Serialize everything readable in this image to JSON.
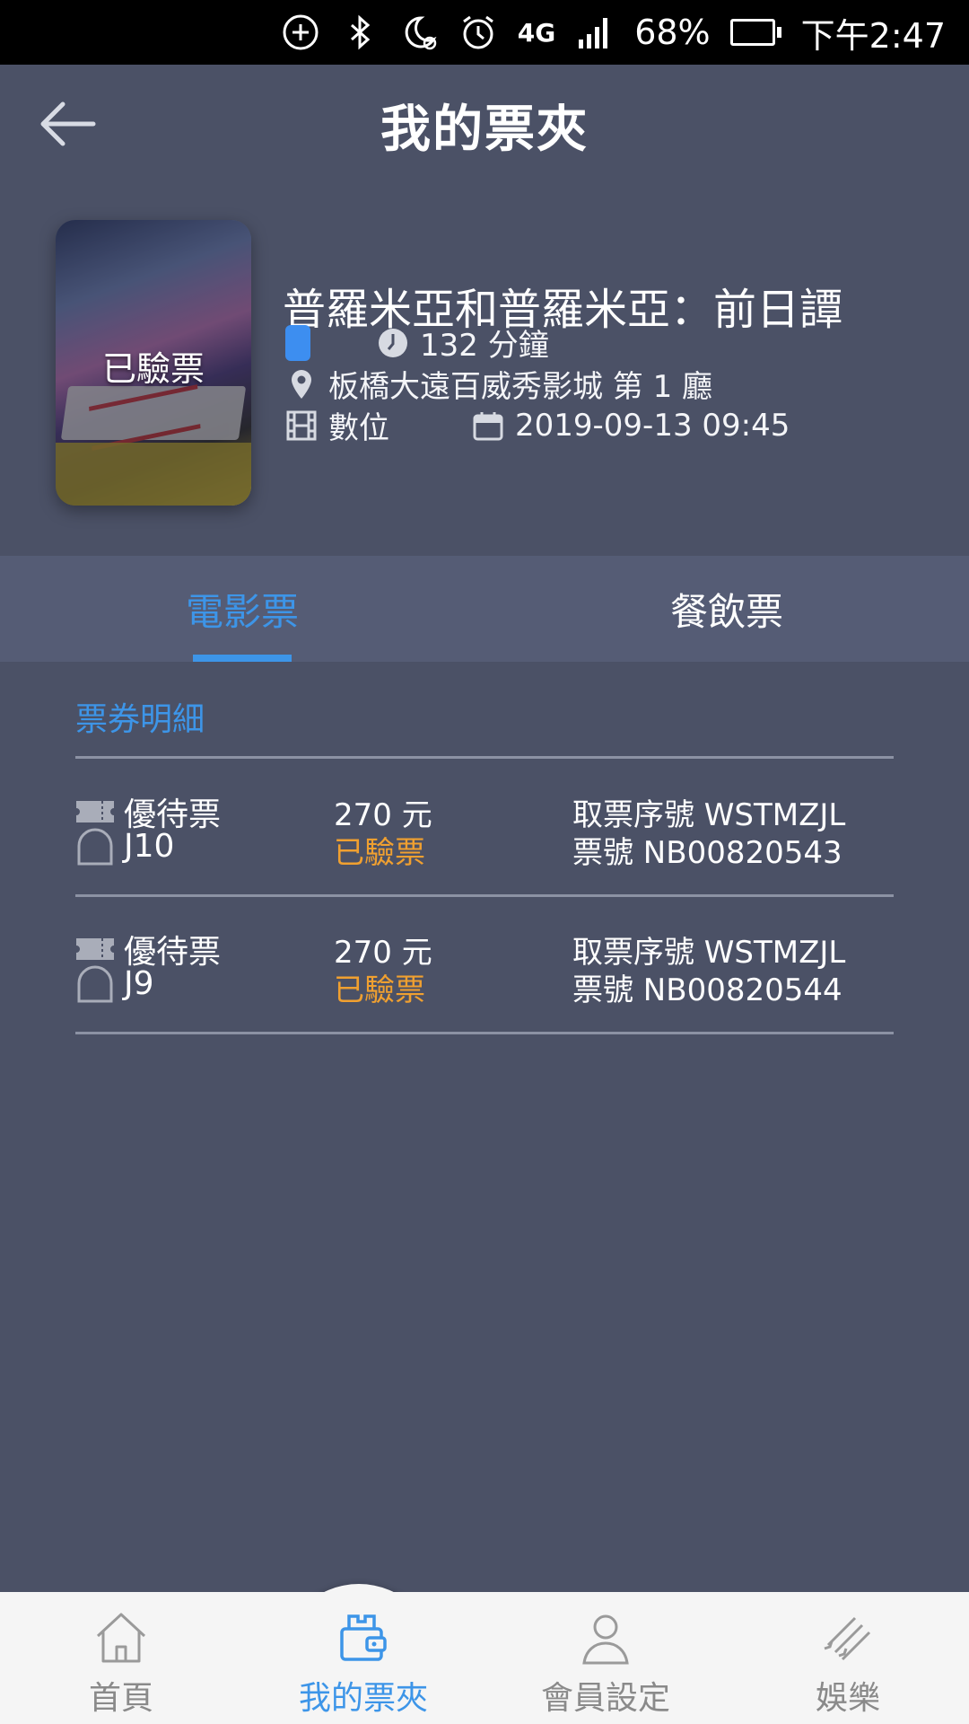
{
  "status_bar": {
    "battery_percent": "68%",
    "battery_level": 0.68,
    "time": "下午2:47",
    "network": "4G",
    "icons": [
      "add-circle-icon",
      "bluetooth-icon",
      "moon-alarm-icon",
      "alarm-icon",
      "network-4g-icon",
      "signal-icon",
      "battery-icon"
    ]
  },
  "header": {
    "title": "我的票夾",
    "back_icon": "back-arrow-icon"
  },
  "movie": {
    "poster_status": "已驗票",
    "title": "普羅米亞和普羅米亞：前日譚",
    "duration": "132 分鐘",
    "cinema": "板橋大遠百威秀影城 第 1 廳",
    "format": "數位",
    "datetime": "2019-09-13 09:45"
  },
  "tabs": [
    {
      "label": "電影票",
      "active": true
    },
    {
      "label": "餐飲票",
      "active": false
    }
  ],
  "detail": {
    "heading": "票券明細",
    "tickets": [
      {
        "type": "優待票",
        "seat": "J10",
        "price": "270 元",
        "status": "已驗票",
        "pickup_code": "取票序號 WSTMZJL",
        "ticket_no": "票號 NB00820543"
      },
      {
        "type": "優待票",
        "seat": "J9",
        "price": "270 元",
        "status": "已驗票",
        "pickup_code": "取票序號 WSTMZJL",
        "ticket_no": "票號 NB00820544"
      }
    ]
  },
  "bottom_nav": [
    {
      "label": "首頁",
      "icon": "home-icon",
      "active": false
    },
    {
      "label": "我的票夾",
      "icon": "wallet-icon",
      "active": true
    },
    {
      "label": "會員設定",
      "icon": "user-icon",
      "active": false
    },
    {
      "label": "娛樂",
      "icon": "entertainment-icon",
      "active": false
    }
  ],
  "colors": {
    "background": "#4b5166",
    "tab_bar": "#555c75",
    "accent": "#3d95e8",
    "status_verified": "#f0a030"
  }
}
